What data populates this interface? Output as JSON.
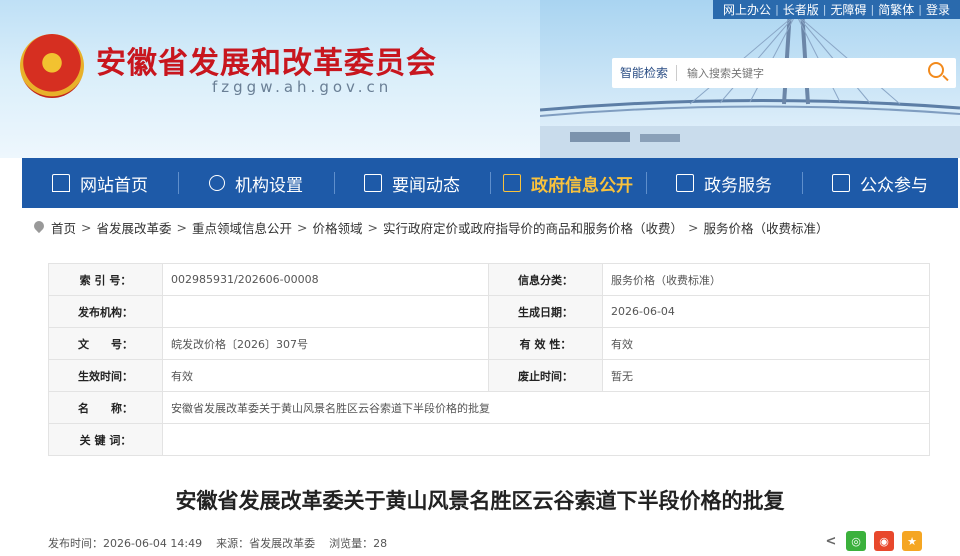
{
  "topbar": {
    "links": [
      "网上办公",
      "长者版",
      "无障碍",
      "简繁体",
      "登录"
    ]
  },
  "header": {
    "title": "安徽省发展和改革委员会",
    "domain": "fzggw.ah.gov.cn"
  },
  "search": {
    "label": "智能检索",
    "placeholder": "输入搜索关键字"
  },
  "nav": {
    "items": [
      {
        "label": "网站首页",
        "icon": "home-icon"
      },
      {
        "label": "机构设置",
        "icon": "org-chart-icon"
      },
      {
        "label": "要闻动态",
        "icon": "news-icon"
      },
      {
        "label": "政府信息公开",
        "icon": "info-disclosure-icon"
      },
      {
        "label": "政务服务",
        "icon": "service-icon"
      },
      {
        "label": "公众参与",
        "icon": "participation-icon"
      }
    ],
    "active_index": 3
  },
  "breadcrumb": {
    "items": [
      "首页",
      "省发展改革委",
      "重点领域信息公开",
      "价格领域",
      "实行政府定价或政府指导价的商品和服务价格（收费）",
      "服务价格（收费标准）"
    ],
    "separator": ">"
  },
  "info": {
    "index_label": "索 引 号：",
    "index_value": "002985931/202606-00008",
    "category_label": "信息分类：",
    "category_value": "服务价格（收费标准）",
    "publisher_label": "发布机构：",
    "publisher_value": "",
    "date_label": "生成日期：",
    "date_value": "2026-06-04",
    "docno_label": "文　　号：",
    "docno_value": "皖发改价格〔2026〕307号",
    "validity_label": "有 效 性：",
    "validity_value": "有效",
    "effective_label": "生效时间：",
    "effective_value": "有效",
    "repeal_label": "废止时间：",
    "repeal_value": "暂无",
    "name_label": "名　　称：",
    "name_value": "安徽省发展改革委关于黄山风景名胜区云谷索道下半段价格的批复",
    "keywords_label": "关 键 词：",
    "keywords_value": ""
  },
  "article": {
    "title": "安徽省发展改革委关于黄山风景名胜区云谷索道下半段价格的批复",
    "publish_time": "发布时间：2026-06-04 14:49",
    "source": "来源：省发展改革委",
    "views": "浏览量：28"
  },
  "colors": {
    "nav_bg": "#1e5aa8",
    "nav_active": "#f9c23c",
    "title_red": "#c8161e",
    "topbar_bg": "#2a6aad"
  }
}
